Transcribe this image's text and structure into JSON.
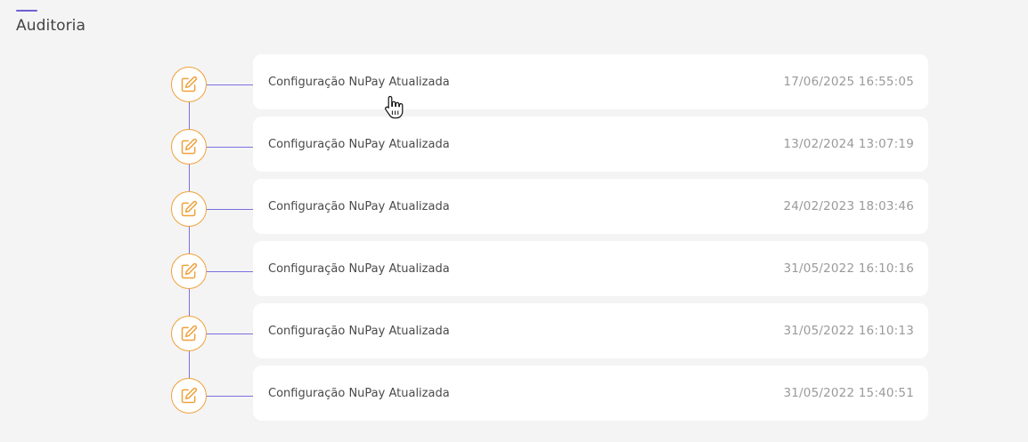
{
  "page": {
    "title": "Auditoria"
  },
  "colors": {
    "accent": "#6f5fd6",
    "timeline_line": "#7b6fe0",
    "icon_orange": "#f0a13a",
    "background": "#f4f4f4",
    "card": "#ffffff"
  },
  "timeline": {
    "entries": [
      {
        "icon": "edit-icon",
        "text": "Configuração NuPay Atualizada",
        "datetime": "17/06/2025 16:55:05"
      },
      {
        "icon": "edit-icon",
        "text": "Configuração NuPay Atualizada",
        "datetime": "13/02/2024 13:07:19"
      },
      {
        "icon": "edit-icon",
        "text": "Configuração NuPay Atualizada",
        "datetime": "24/02/2023 18:03:46"
      },
      {
        "icon": "edit-icon",
        "text": "Configuração NuPay Atualizada",
        "datetime": "31/05/2022 16:10:16"
      },
      {
        "icon": "edit-icon",
        "text": "Configuração NuPay Atualizada",
        "datetime": "31/05/2022 16:10:13"
      },
      {
        "icon": "edit-icon",
        "text": "Configuração NuPay Atualizada",
        "datetime": "31/05/2022 15:40:51"
      }
    ]
  }
}
